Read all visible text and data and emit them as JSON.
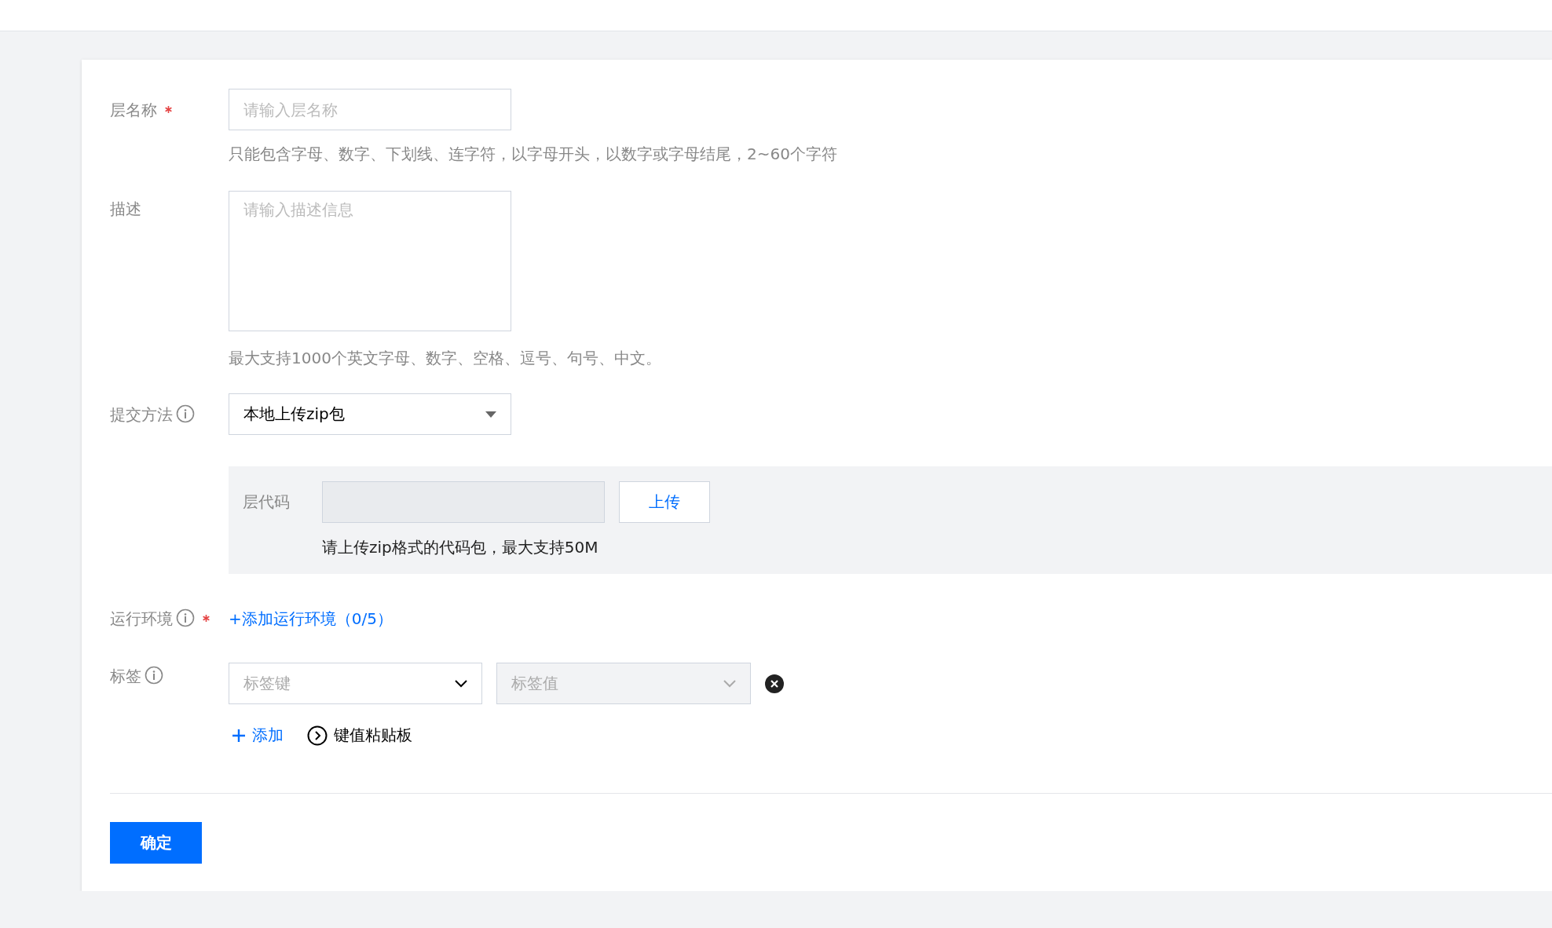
{
  "fields": [
    {
      "kind": "input",
      "label": "层名称",
      "required": true,
      "info": false,
      "placeholder": "请输入层名称",
      "hint": "只能包含字母、数字、下划线、连字符，以字母开头，以数字或字母结尾，2~60个字符"
    },
    {
      "kind": "textarea",
      "label": "描述",
      "required": false,
      "info": false,
      "placeholder": "请输入描述信息",
      "hint": "最大支持1000个英文字母、数字、空格、逗号、句号、中文。"
    },
    {
      "kind": "select",
      "label": "提交方法",
      "required": false,
      "info": true,
      "value": "本地上传zip包"
    }
  ],
  "upload": {
    "label": "层代码",
    "button": "上传",
    "hint": "请上传zip格式的代码包，最大支持50M"
  },
  "runtime": {
    "label": "运行环境",
    "required": true,
    "info": true,
    "link": "+添加运行环境（0/5）"
  },
  "tags": {
    "label": "标签",
    "required": false,
    "info": true,
    "key_placeholder": "标签键",
    "value_placeholder": "标签值",
    "value_disabled": true,
    "add": "添加",
    "clipboard": "键值粘贴板"
  },
  "submit": "确定"
}
